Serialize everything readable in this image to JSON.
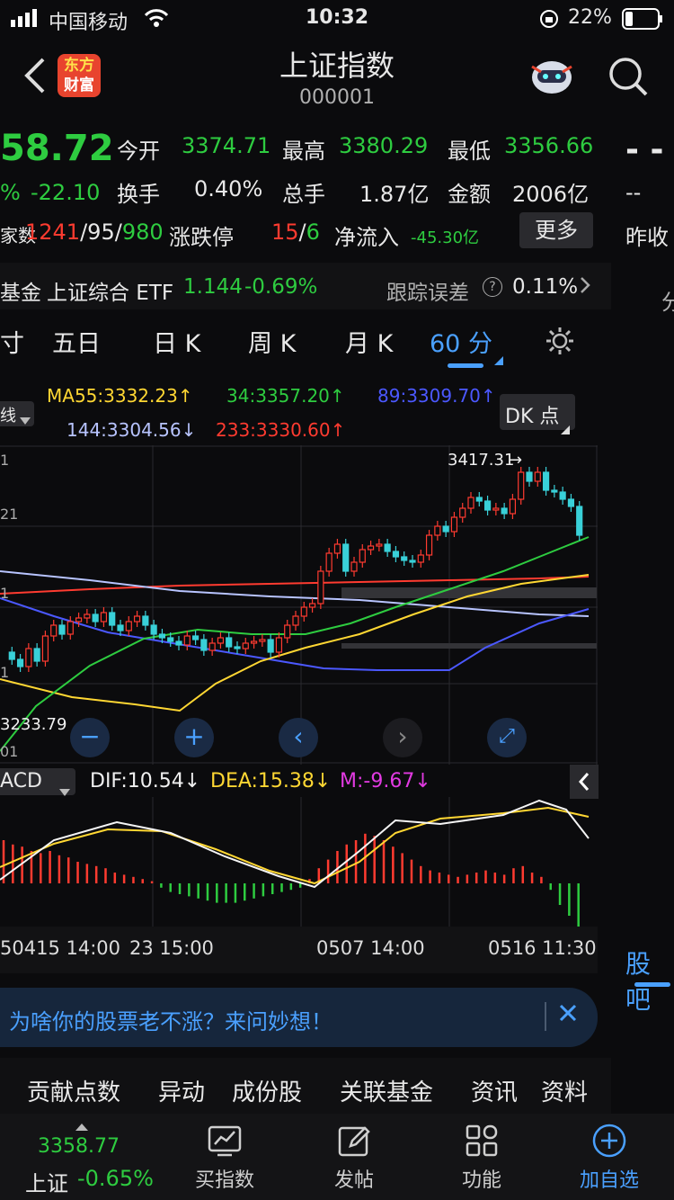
{
  "status": {
    "carrier": "中国移动",
    "time": "10:32",
    "battery": "22%"
  },
  "header": {
    "title": "上证指数",
    "code": "000001",
    "logo_line1": "东方",
    "logo_line2": "财富"
  },
  "quote": {
    "price": "58.72",
    "change_pct": "%",
    "change": "-22.10",
    "open_label": "今开",
    "open": "3374.71",
    "high_label": "最高",
    "high": "3380.29",
    "low_label": "最低",
    "low": "3356.66",
    "turnover_label": "换手",
    "turnover": "0.40%",
    "volume_label": "总手",
    "volume": "1.87亿",
    "amount_label": "金额",
    "amount": "2006亿",
    "count_label": "家数",
    "up_count": "1241",
    "sep1": "/",
    "flat_count": "95",
    "sep2": "/",
    "down_count": "980",
    "limit_label": "涨跌停",
    "limit_up": "15",
    "sep3": "/",
    "limit_down": "6",
    "inflow_label": "净流入",
    "inflow": "-45.30亿",
    "more_label": "更多",
    "side_dashes": "- -",
    "side_dash2": "--",
    "side_prev": "昨收"
  },
  "fund": {
    "prefix": "基金",
    "name": "上证综合 ETF",
    "price": "1.144",
    "pct": "-0.69%",
    "err_label": "跟踪误差",
    "err": "0.11%"
  },
  "tabs": {
    "t0": "寸",
    "t1": "五日",
    "t2": "日 K",
    "t3": "周 K",
    "t4": "月 K",
    "t5": "60 分",
    "side": "分"
  },
  "ma": {
    "sel": "线",
    "ma55": "MA55:3332.23",
    "ma34": "34:3357.20",
    "ma89": "89:3309.70",
    "ma144": "144:3304.56",
    "ma233": "233:3330.60",
    "dk": "DK 点",
    "up": "↑",
    "down": "↓"
  },
  "chart_labels": {
    "high_mark": "3417.31",
    "low_mark": "3233.79",
    "y1": "1",
    "y2": "21",
    "y3": "1",
    "y4": "1",
    "y5": "01"
  },
  "macd": {
    "sel": "ACD",
    "dif": "DIF:10.54",
    "dea": "DEA:15.38",
    "m": "M:-9.67",
    "down": "↓"
  },
  "xaxis": {
    "l1": "50415 14:00",
    "l2": "23 15:00",
    "l3": "0507 14:00",
    "l4": "0516 11:30"
  },
  "side_tab": "股吧",
  "banner": {
    "text": "为啥你的股票老不涨？来问妙想！"
  },
  "tagbar": {
    "t1": "贡献点数",
    "t2": "异动",
    "t3": "成份股",
    "t4": "关联基金",
    "t5": "资讯",
    "t6": "资料"
  },
  "bottom": {
    "price": "3358.77",
    "name": "上证",
    "pct": "-0.65%",
    "n1": "买指数",
    "n2": "发帖",
    "n3": "功能",
    "n4": "加自选"
  },
  "colors": {
    "up": "#ff3b30",
    "down": "#2ecc40",
    "accent": "#4aa0ff"
  }
}
